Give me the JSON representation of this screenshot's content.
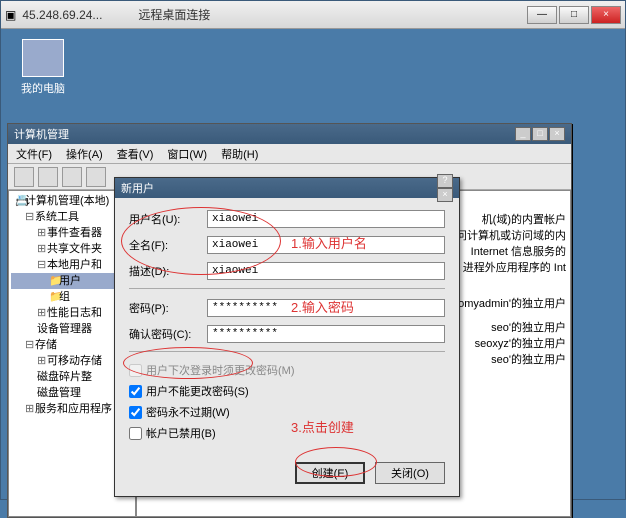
{
  "rdp": {
    "ip": "45.248.69.24...",
    "title": "远程桌面连接",
    "min": "—",
    "max": "□",
    "close": "×"
  },
  "desktop": {
    "my_computer": "我的电脑"
  },
  "cmgmt": {
    "title": "计算机管理",
    "min": "_",
    "max": "□",
    "close": "×",
    "menu": {
      "file": "文件(F)",
      "action": "操作(A)",
      "view": "查看(V)",
      "window": "窗口(W)",
      "help": "帮助(H)"
    },
    "tree": {
      "root": "计算机管理(本地)",
      "sys_tools": "系统工具",
      "event_viewer": "事件查看器",
      "shared_folders": "共享文件夹",
      "local_users": "本地用户和",
      "users": "用户",
      "groups": "组",
      "perf": "性能日志和",
      "devmgr": "设备管理器",
      "storage": "存储",
      "removable": "可移动存储",
      "defrag": "磁盘碎片整",
      "diskmgr": "磁盘管理",
      "services": "服务和应用程序"
    },
    "rlist": {
      "r1": "机(域)的内置帐户",
      "r2": "问计算机或访问域的内",
      "r3": "Internet 信息服务的",
      "r4": "进程外应用程序的 Int",
      "r5": "omyadmin'的独立用户",
      "r6": "seo'的独立用户",
      "r7": "seoxyz'的独立用户",
      "r8": "seo'的独立用户"
    }
  },
  "dialog": {
    "title": "新用户",
    "help": "?",
    "close": "×",
    "labels": {
      "username": "用户名(U):",
      "fullname": "全名(F):",
      "desc": "描述(D):",
      "password": "密码(P):",
      "confirm": "确认密码(C):"
    },
    "values": {
      "username": "xiaowei",
      "fullname": "xiaowei",
      "desc": "xiaowei",
      "passmask": "**********"
    },
    "checks": {
      "must_change": "用户下次登录时须更改密码(M)",
      "cannot_change": "用户不能更改密码(S)",
      "never_expire": "密码永不过期(W)",
      "disabled": "帐户已禁用(B)"
    },
    "buttons": {
      "create": "创建(E)",
      "close": "关闭(O)"
    }
  },
  "anno": {
    "a1": "1.输入用户名",
    "a2": "2.输入密码",
    "a3": "3.点击创建"
  }
}
